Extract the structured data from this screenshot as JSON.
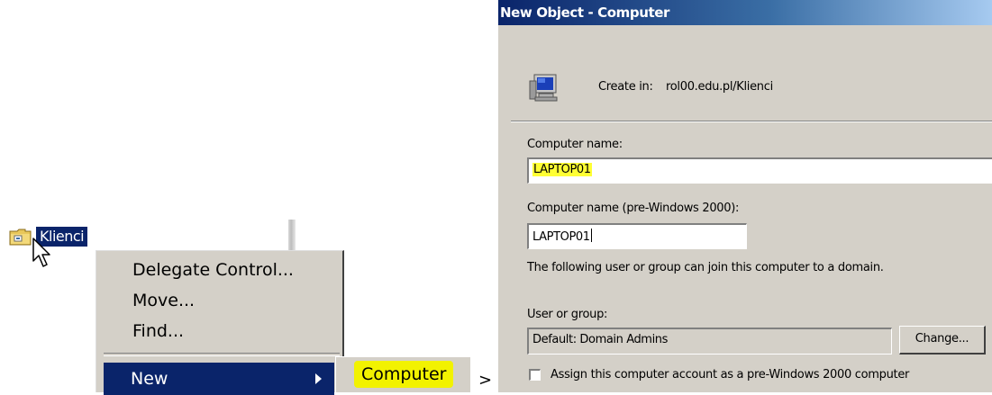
{
  "tree": {
    "node_label": "Klienci"
  },
  "context_menu": {
    "items": [
      {
        "label": "Delegate Control..."
      },
      {
        "label": "Move..."
      },
      {
        "label": "Find..."
      }
    ],
    "new_label": "New",
    "submenu": {
      "computer_label": "Computer"
    }
  },
  "arrow_glyph": ">",
  "dialog": {
    "title": "New Object - Computer",
    "create_in_label": "Create in:",
    "create_in_path": "rol00.edu.pl/Klienci",
    "computer_name_label": "Computer name:",
    "computer_name_value": "LAPTOP01",
    "pre2000_label": "Computer name (pre-Windows 2000):",
    "pre2000_value": "LAPTOP01",
    "join_info": "The following user or group can join this computer to a domain.",
    "user_group_label": "User or group:",
    "user_group_value": "Default: Domain Admins",
    "change_button": "Change...",
    "assign_checkbox_label": "Assign this computer account as a pre-Windows 2000 computer",
    "assign_checked": false
  },
  "colors": {
    "menu_bg": "#d4d0c8",
    "selection": "#0a246a",
    "highlighter": "#ffff33"
  }
}
